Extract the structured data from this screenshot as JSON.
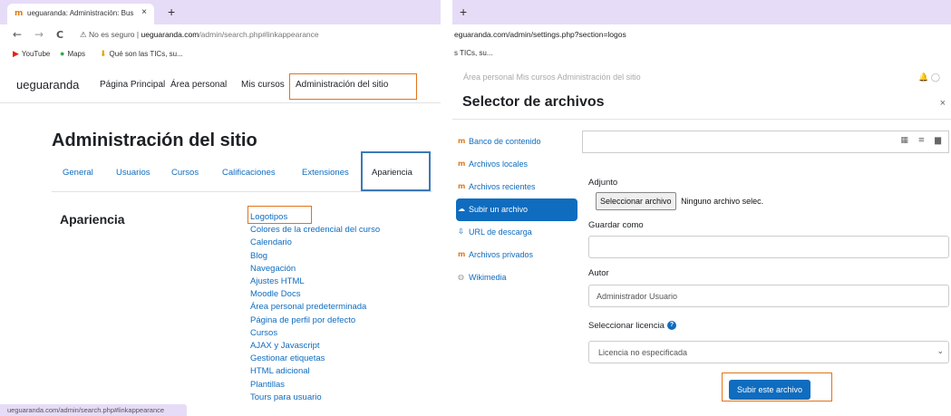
{
  "left": {
    "tab_title": "ueguaranda: Administración: Bus",
    "tab_favicon": "moodle-icon",
    "tab_close": "×",
    "newtab": "+",
    "nav": {
      "back": "←",
      "forward": "→",
      "reload": "C"
    },
    "url_warn": "⚠ No es seguro",
    "url_sep": "|",
    "url_host": "ueguaranda.com",
    "url_path": "/admin/search.php#linkappearance",
    "bookmarks": [
      {
        "icon": "youtube-icon",
        "label": "YouTube"
      },
      {
        "icon": "maps-icon",
        "label": "Maps"
      },
      {
        "icon": "download-icon",
        "label": "Qué son las TICs, su..."
      }
    ],
    "brand": "ueguaranda",
    "navlinks": [
      "Página Principal",
      "Área personal",
      "Mis cursos",
      "Administración del sitio"
    ],
    "page_title": "Administración del sitio",
    "subtabs": [
      "General",
      "Usuarios",
      "Cursos",
      "Calificaciones",
      "Extensiones",
      "Apariencia"
    ],
    "section_title": "Apariencia",
    "appearance_items": [
      "Logotipos",
      "Colores de la credencial del curso",
      "Calendario",
      "Blog",
      "Navegación",
      "Ajustes HTML",
      "Moodle Docs",
      "Área personal predeterminada",
      "Página de perfil por defecto",
      "Cursos",
      "AJAX y Javascript",
      "Gestionar etiquetas",
      "HTML adicional",
      "Plantillas",
      "Tours para usuario"
    ],
    "status_url": "ueguaranda.com/admin/search.php#linkappearance"
  },
  "right": {
    "newtab": "+",
    "url": "eguaranda.com/admin/settings.php?section=logos",
    "bookmark": "s TICs, su...",
    "behind_text": "Área personal   Mis cursos   Administración del sitio",
    "behind_icons": "🔔  ◯",
    "modal_title": "Selector de archivos",
    "close": "×",
    "repos": [
      {
        "icon": "moodle-icon",
        "label": "Banco de contenido"
      },
      {
        "icon": "moodle-icon",
        "label": "Archivos locales"
      },
      {
        "icon": "moodle-icon",
        "label": "Archivos recientes"
      },
      {
        "icon": "upload-icon",
        "label": "Subir un archivo",
        "active": true
      },
      {
        "icon": "link-icon",
        "label": "URL de descarga"
      },
      {
        "icon": "moodle-icon",
        "label": "Archivos privados"
      },
      {
        "icon": "globe-icon",
        "label": "Wikimedia"
      }
    ],
    "view_icons": "▦ ≡ ▆",
    "attach_label": "Adjunto",
    "file_button": "Seleccionar archivo",
    "file_none": "Ninguno archivo selec.",
    "save_as_label": "Guardar como",
    "save_as_value": "",
    "author_label": "Autor",
    "author_value": "Administrador Usuario",
    "license_label": "Seleccionar licencia",
    "help": "?",
    "license_value": "Licencia no especificada",
    "chevron": "⌄",
    "submit": "Subir este archivo"
  }
}
